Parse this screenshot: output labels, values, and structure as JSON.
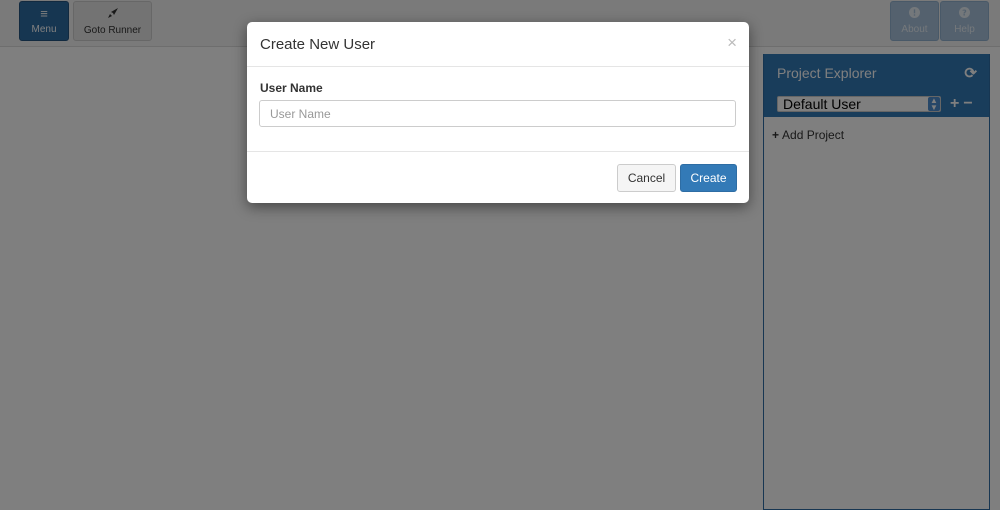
{
  "toolbar": {
    "menu_label": "Menu",
    "goto_runner_label": "Goto Runner",
    "about_label": "About",
    "help_label": "Help",
    "icons": {
      "menu": "≡",
      "goto": "🚀",
      "about": "❗",
      "help": "?"
    }
  },
  "explorer": {
    "title": "Project Explorer",
    "refresh_icon": "⟳",
    "selected_user": "Default User",
    "add_icon": "+",
    "remove_icon": "−",
    "add_project_label": "Add Project"
  },
  "modal": {
    "title": "Create New User",
    "close_glyph": "×",
    "field_label": "User Name",
    "field_placeholder": "User Name",
    "field_value": "",
    "cancel_label": "Cancel",
    "create_label": "Create"
  },
  "colors": {
    "primary": "#337ab7",
    "primary_border": "#2e6da4",
    "backdrop": "rgba(0,0,0,0.5)"
  }
}
